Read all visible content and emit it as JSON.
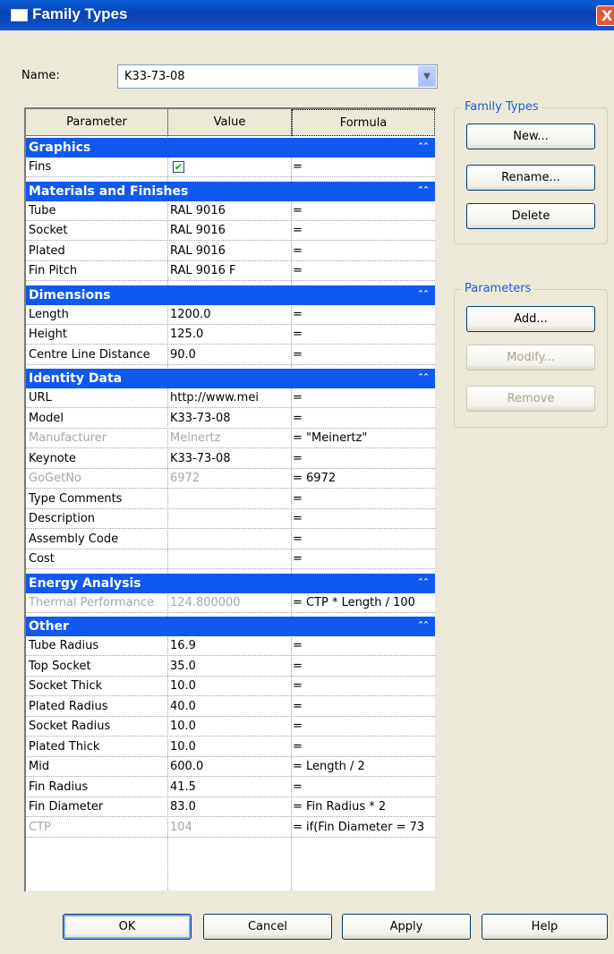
{
  "window": {
    "title": "Family Types",
    "close": "X"
  },
  "name_field": {
    "label": "Name:",
    "value": "K33-73-08"
  },
  "table": {
    "headers": [
      "Parameter",
      "Value",
      "Formula"
    ],
    "sections": [
      {
        "title": "Graphics",
        "rows": [
          {
            "param": "Fins",
            "value": "",
            "formula": "=",
            "checkbox": true
          }
        ]
      },
      {
        "title": "Materials and Finishes",
        "rows": [
          {
            "param": "Tube",
            "value": "RAL 9016",
            "formula": "="
          },
          {
            "param": "Socket",
            "value": "RAL 9016",
            "formula": "="
          },
          {
            "param": "Plated",
            "value": "RAL 9016",
            "formula": "="
          },
          {
            "param": "Fin Pitch",
            "value": "RAL 9016 F",
            "formula": "="
          }
        ]
      },
      {
        "title": "Dimensions",
        "rows": [
          {
            "param": "Length",
            "value": "1200.0",
            "formula": "="
          },
          {
            "param": "Height",
            "value": "125.0",
            "formula": "="
          },
          {
            "param": "Centre Line Distance",
            "value": "90.0",
            "formula": "="
          }
        ]
      },
      {
        "title": "Identity Data",
        "rows": [
          {
            "param": "URL",
            "value": "http://www.mei",
            "formula": "="
          },
          {
            "param": "Model",
            "value": "K33-73-08",
            "formula": "="
          },
          {
            "param": "Manufacturer",
            "value": "Meinertz",
            "formula": "= \"Meinertz\"",
            "readonly": true
          },
          {
            "param": "Keynote",
            "value": "K33-73-08",
            "formula": "="
          },
          {
            "param": "GoGetNo",
            "value": "6972",
            "formula": "= 6972",
            "readonly": true
          },
          {
            "param": "Type Comments",
            "value": "",
            "formula": "="
          },
          {
            "param": "Description",
            "value": "",
            "formula": "="
          },
          {
            "param": "Assembly Code",
            "value": "",
            "formula": "="
          },
          {
            "param": "Cost",
            "value": "",
            "formula": "="
          }
        ]
      },
      {
        "title": "Energy Analysis",
        "rows": [
          {
            "param": "Thermal Performance",
            "value": "124.800000",
            "formula": "= CTP * Length / 100",
            "readonly": true
          }
        ]
      },
      {
        "title": "Other",
        "rows": [
          {
            "param": "Tube Radius",
            "value": "16.9",
            "formula": "="
          },
          {
            "param": "Top Socket",
            "value": "35.0",
            "formula": "="
          },
          {
            "param": "Socket Thick",
            "value": "10.0",
            "formula": "="
          },
          {
            "param": "Plated Radius",
            "value": "40.0",
            "formula": "="
          },
          {
            "param": "Socket Radius",
            "value": "10.0",
            "formula": "="
          },
          {
            "param": "Plated Thick",
            "value": "10.0",
            "formula": "="
          },
          {
            "param": "Mid",
            "value": "600.0",
            "formula": "= Length / 2"
          },
          {
            "param": "Fin Radius",
            "value": "41.5",
            "formula": "="
          },
          {
            "param": "Fin Diameter",
            "value": "83.0",
            "formula": "= Fin Radius * 2"
          },
          {
            "param": "CTP",
            "value": "104",
            "formula": "= if(Fin Diameter = 73",
            "readonly": true
          }
        ]
      }
    ]
  },
  "family_types_group": {
    "title": "Family Types",
    "new": "New...",
    "rename": "Rename...",
    "delete": "Delete"
  },
  "parameters_group": {
    "title": "Parameters",
    "add": "Add...",
    "modify": "Modify...",
    "remove": "Remove"
  },
  "footer": {
    "ok": "OK",
    "cancel": "Cancel",
    "apply": "Apply",
    "help": "Help"
  }
}
